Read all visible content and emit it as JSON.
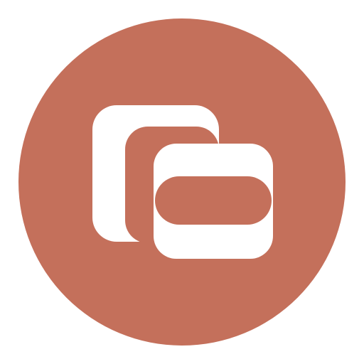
{
  "app_icon": {
    "icon": "stacked-cards-icon",
    "colors": {
      "page_background": "#ffffff",
      "badge_background": "#c4705b",
      "foreground": "#ffffff"
    }
  }
}
